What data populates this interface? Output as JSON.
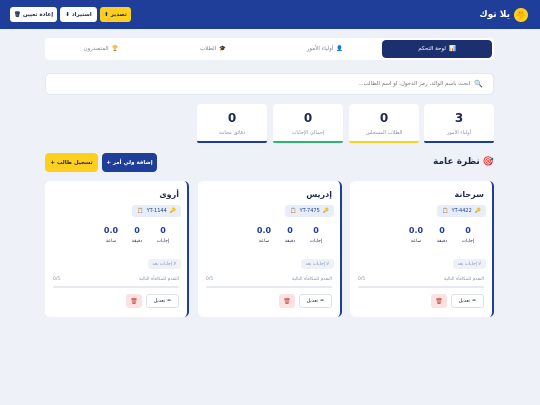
{
  "header": {
    "brand_name": "يلا توك",
    "brand_icon": "🐥",
    "export_label": "تصدير",
    "export_icon": "⬆",
    "import_label": "استيراد",
    "import_icon": "⬇",
    "reset_label": "إعادة تعيين",
    "reset_icon": "🗑"
  },
  "tabs": [
    {
      "label": "لوحة التحكم",
      "icon": "📊"
    },
    {
      "label": "أولياء الأمور",
      "icon": "👤"
    },
    {
      "label": "الطلاب",
      "icon": "🎓"
    },
    {
      "label": "المتصدرون",
      "icon": "🏆"
    }
  ],
  "search": {
    "placeholder": "ابحث باسم الوالد، رمز الدخول، أو اسم الطالب...",
    "icon": "🔍"
  },
  "stats": [
    {
      "value": "3",
      "label": "أولياء الأمور",
      "color": "#1f3e99"
    },
    {
      "value": "0",
      "label": "الطلاب المسجلين",
      "color": "#ffcf1f"
    },
    {
      "value": "0",
      "label": "إجمالي الإجابات",
      "color": "#2bb673"
    },
    {
      "value": "0",
      "label": "دقائق مجانية",
      "color": "#1f3e99"
    }
  ],
  "overview": {
    "title": "نظرة عامة",
    "icon": "🎯",
    "add_parent_label": "+ إضافة ولي أمر",
    "add_student_label": "+ تسجيل طالب"
  },
  "card_labels": {
    "answers": "إجابات",
    "minutes": "دقيقة",
    "hours": "ساعة",
    "no_answers": "لا إجابات بعد",
    "progress_label": "التقدم للمكافأة التالية",
    "edit": "تعديل",
    "edit_icon": "✏",
    "delete_icon": "🗑",
    "key_icon": "🔑",
    "copy_icon": "📋"
  },
  "cards": [
    {
      "name": "سرحانة",
      "code": "YT-4422",
      "answers": "0",
      "minutes": "0",
      "hours": "0.0",
      "progress_text": "0/5",
      "progress": 0
    },
    {
      "name": "إدريس",
      "code": "YT-7475",
      "answers": "0",
      "minutes": "0",
      "hours": "0.0",
      "progress_text": "0/5",
      "progress": 0
    },
    {
      "name": "أروى",
      "code": "YT-1144",
      "answers": "0",
      "minutes": "0",
      "hours": "0.0",
      "progress_text": "0/5",
      "progress": 0
    }
  ]
}
